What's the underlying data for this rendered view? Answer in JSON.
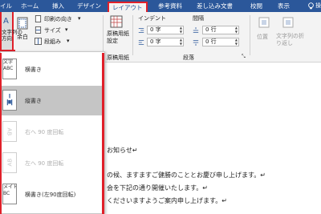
{
  "tabs": [
    {
      "label": "イル",
      "active": false
    },
    {
      "label": "ホーム",
      "active": false
    },
    {
      "label": "挿入",
      "active": false
    },
    {
      "label": "デザイン",
      "active": false
    },
    {
      "label": "レイアウト",
      "active": true
    },
    {
      "label": "参考資料",
      "active": false
    },
    {
      "label": "差し込み文書",
      "active": false
    },
    {
      "label": "校閲",
      "active": false
    },
    {
      "label": "表示",
      "active": false
    }
  ],
  "tab_tail": "操",
  "ribbon": {
    "text_direction_label": "文字列の\n方向",
    "margins_label": "余白",
    "orientation_label": "印刷の向き",
    "size_label": "サイズ",
    "columns_label": "段組み",
    "genko_label": "原稿用紙\n設定",
    "genko_group": "原稿用紙",
    "indent_label": "インデント",
    "spacing_label": "間隔",
    "indent_left": "0 字",
    "indent_right": "0 字",
    "spacing_before": "0 行",
    "spacing_after": "0 行",
    "paragraph_group": "段落",
    "position_label": "位置",
    "wrap_label": "文字列の折\nり返し"
  },
  "dropdown": {
    "items": [
      {
        "label": "横書き",
        "thumb": "文字\nABC",
        "selected": false,
        "disabled": false
      },
      {
        "label": "縦書き",
        "thumb": "",
        "selected": true,
        "disabled": false
      },
      {
        "label": "右へ 90 度回転",
        "thumb": "",
        "selected": false,
        "disabled": true
      },
      {
        "label": "左へ 90 度回転",
        "thumb": "",
        "selected": false,
        "disabled": true
      },
      {
        "label": "横書き(左90度回転)",
        "thumb": "メイト\nBC",
        "selected": false,
        "disabled": false
      }
    ]
  },
  "document": {
    "lines": [
      "お知らせ↵",
      "の候、ますますご健勝のこととお慶び申し上げます。↵",
      "会を下記の通り開催いたします。↵",
      "くださいますようご案内申し上げます。↵"
    ]
  },
  "colors": {
    "ribbon_blue": "#2b579a",
    "highlight_red": "#e0202a"
  }
}
